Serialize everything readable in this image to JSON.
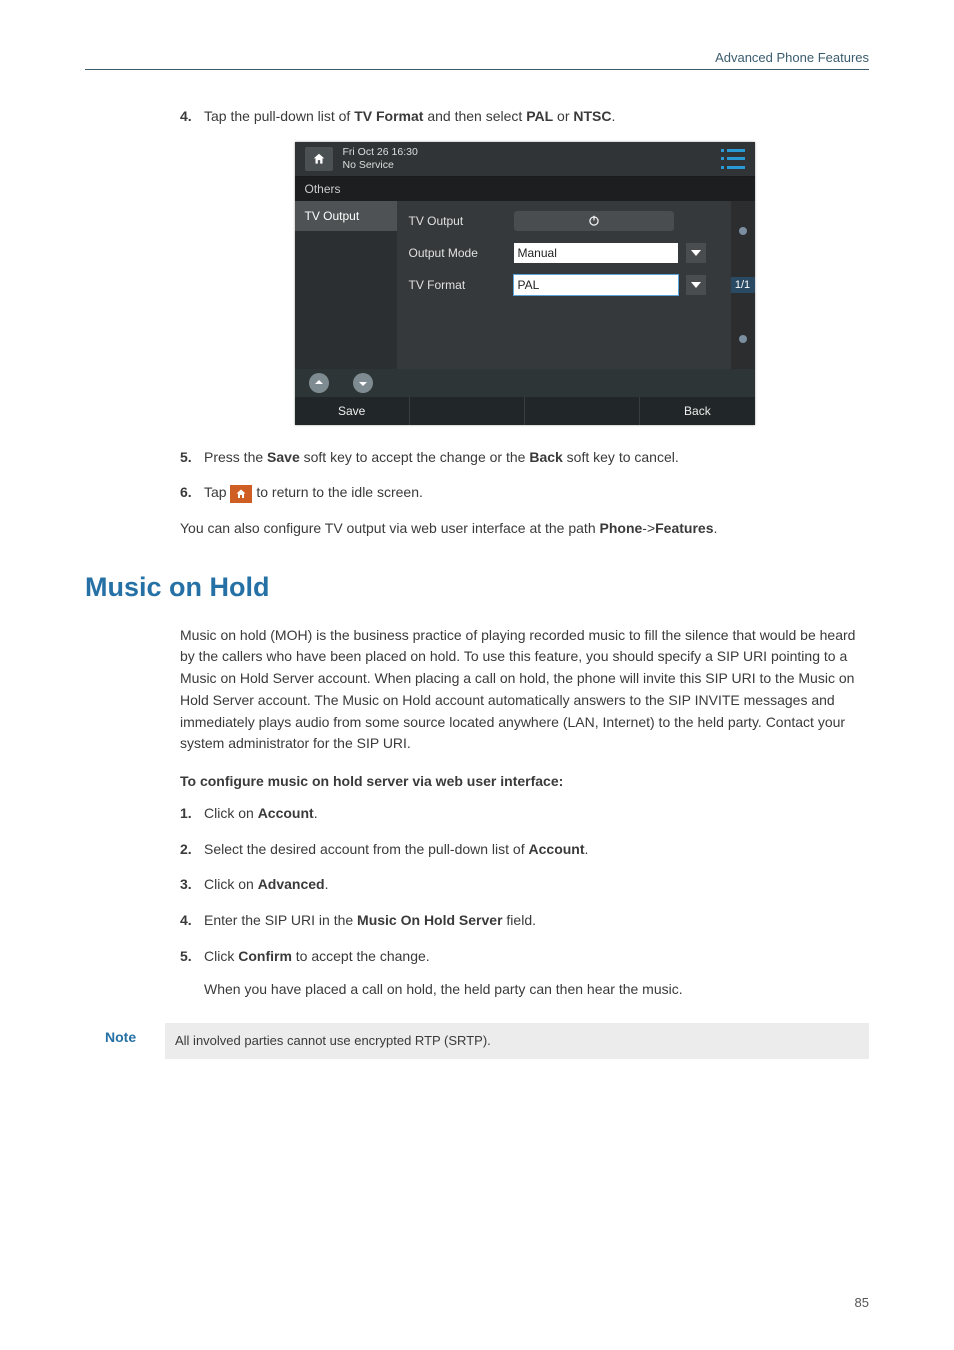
{
  "header": {
    "section_title": "Advanced Phone Features"
  },
  "step4": {
    "num": "4.",
    "pre": "Tap the pull-down list of ",
    "b1": "TV Format",
    "mid": " and then select ",
    "b2": "PAL",
    "or": " or ",
    "b3": "NTSC",
    "end": "."
  },
  "phone": {
    "time": "Fri Oct 26 16:30",
    "service": "No Service",
    "tab": "Others",
    "side_item": "TV Output",
    "row1_label": "TV Output",
    "row2_label": "Output Mode",
    "row2_value": "Manual",
    "row3_label": "TV Format",
    "row3_value": "PAL",
    "page_ind": "1/1",
    "soft_save": "Save",
    "soft_back": "Back"
  },
  "step5": {
    "num": "5.",
    "pre": "Press the ",
    "b1": "Save",
    "mid": " soft key to accept the change or the ",
    "b2": "Back",
    "end": " soft key to cancel."
  },
  "step6": {
    "num": "6.",
    "pre": "Tap ",
    "post": " to return to the idle screen."
  },
  "para_after": {
    "pre": "You can also configure TV output via web user interface at the path ",
    "b1": "Phone",
    "arrow": "->",
    "b2": "Features",
    "end": "."
  },
  "section_heading": "Music on Hold",
  "moh_para": "Music on hold (MOH) is the business practice of playing recorded music to fill the silence that would be heard by the callers who have been placed on hold. To use this feature, you should specify a SIP URI pointing to a Music on Hold Server account. When placing a call on hold, the phone will invite this SIP URI to the Music on Hold Server account. The Music on Hold account automatically answers to the SIP INVITE messages and immediately plays audio from some source located anywhere (LAN, Internet) to the held party. Contact your system administrator for the SIP URI.",
  "moh_sub": "To configure music on hold server via web user interface:",
  "m1": {
    "num": "1.",
    "pre": "Click on ",
    "b": "Account",
    "end": "."
  },
  "m2": {
    "num": "2.",
    "pre": "Select the desired account from the pull-down list of ",
    "b": "Account",
    "end": "."
  },
  "m3": {
    "num": "3.",
    "pre": "Click on ",
    "b": "Advanced",
    "end": "."
  },
  "m4": {
    "num": "4.",
    "pre": "Enter the SIP URI in the ",
    "b": "Music On Hold Server",
    "end": " field."
  },
  "m5": {
    "num": "5.",
    "pre": "Click ",
    "b": "Confirm",
    "end": " to accept the change."
  },
  "m5_tail": "When you have placed a call on hold, the held party can then hear the music.",
  "note_label": "Note",
  "note_body": "All involved parties cannot use encrypted RTP (SRTP).",
  "page_number": "85"
}
